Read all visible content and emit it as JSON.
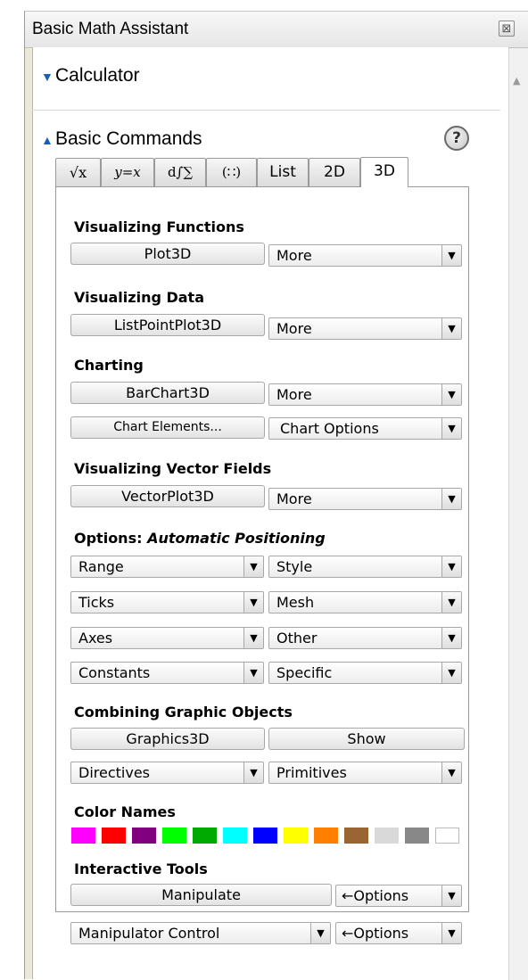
{
  "window": {
    "title": "Basic Math Assistant",
    "close_icon": "close-icon"
  },
  "sections": {
    "calculator": {
      "label": "Calculator",
      "expanded": false
    },
    "basic_commands": {
      "label": "Basic Commands",
      "expanded": true,
      "help": "?"
    }
  },
  "tabs": [
    {
      "label": "√x",
      "icon": "sqrt-x-tab"
    },
    {
      "label": "y=x",
      "icon": "equation-tab"
    },
    {
      "label": "d∫∑",
      "icon": "calculus-tab"
    },
    {
      "label": "(∷)",
      "icon": "matrix-tab"
    },
    {
      "label": "List"
    },
    {
      "label": "2D"
    },
    {
      "label": "3D",
      "active": true
    }
  ],
  "content": {
    "visualizing_functions": {
      "title": "Visualizing Functions",
      "button": "Plot3D",
      "more": "More"
    },
    "visualizing_data": {
      "title": "Visualizing Data",
      "button": "ListPointPlot3D",
      "more": "More"
    },
    "charting": {
      "title": "Charting",
      "button": "BarChart3D",
      "more": "More",
      "elements": "Chart Elements...",
      "options": "Chart Options"
    },
    "vector_fields": {
      "title": "Visualizing Vector Fields",
      "button": "VectorPlot3D",
      "more": "More"
    },
    "options": {
      "title_prefix": "Options: ",
      "title_italic": "Automatic Positioning",
      "dropdowns": [
        "Range",
        "Style",
        "Ticks",
        "Mesh",
        "Axes",
        "Other",
        "Constants",
        "Specific"
      ]
    },
    "combining": {
      "title": "Combining Graphic Objects",
      "graphics": "Graphics3D",
      "show": "Show",
      "directives": "Directives",
      "primitives": "Primitives"
    },
    "color_names": {
      "title": "Color Names",
      "colors": [
        "#ff00ff",
        "#ff0000",
        "#800080",
        "#00ff00",
        "#00aa00",
        "#00ffff",
        "#0000ff",
        "#ffff00",
        "#ff8000",
        "#996633",
        "#d9d9d9",
        "#888888",
        "#ffffff"
      ]
    },
    "interactive": {
      "title": "Interactive Tools",
      "manipulate": "Manipulate",
      "options1": "←Options",
      "control": "Manipulator Control",
      "options2": "←Options"
    }
  }
}
